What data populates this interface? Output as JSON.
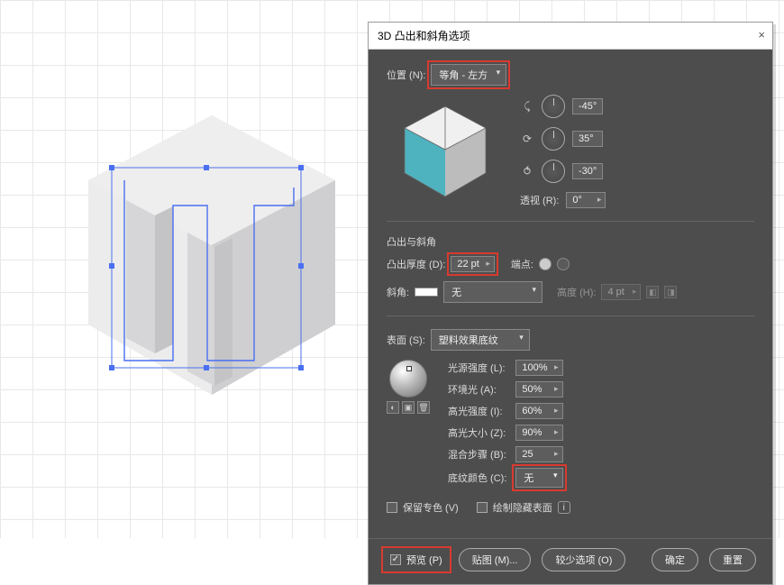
{
  "dialog": {
    "title": "3D 凸出和斜角选项",
    "position": {
      "label": "位置 (N):",
      "value": "等角 - 左方"
    },
    "rotation": {
      "rx": "-45°",
      "ry": "35°",
      "rz": "-30°",
      "perspective_label": "透视 (R):",
      "perspective": "0°"
    },
    "extrude": {
      "section": "凸出与斜角",
      "depth_label": "凸出厚度 (D):",
      "depth": "22 pt",
      "cap_label": "端点:",
      "bevel_label": "斜角:",
      "bevel_value": "无",
      "bevel_height_label": "高度 (H):",
      "bevel_height": "4 pt"
    },
    "surface": {
      "label": "表面 (S):",
      "value": "塑料效果底纹",
      "light_intensity_label": "光源强度 (L):",
      "light_intensity": "100%",
      "ambient_label": "环境光 (A):",
      "ambient": "50%",
      "highlight_intensity_label": "高光强度 (I):",
      "highlight_intensity": "60%",
      "highlight_size_label": "高光大小 (Z):",
      "highlight_size": "90%",
      "blend_steps_label": "混合步骤 (B):",
      "blend_steps": "25",
      "shade_color_label": "底纹颜色 (C):",
      "shade_color": "无"
    },
    "footer": {
      "preserve_spot_label": "保留专色 (V)",
      "draw_hidden_label": "绘制隐藏表面"
    },
    "buttons": {
      "preview": "预览 (P)",
      "map_art": "贴图 (M)...",
      "fewer": "较少选项 (O)",
      "ok": "确定",
      "reset": "重置"
    }
  }
}
